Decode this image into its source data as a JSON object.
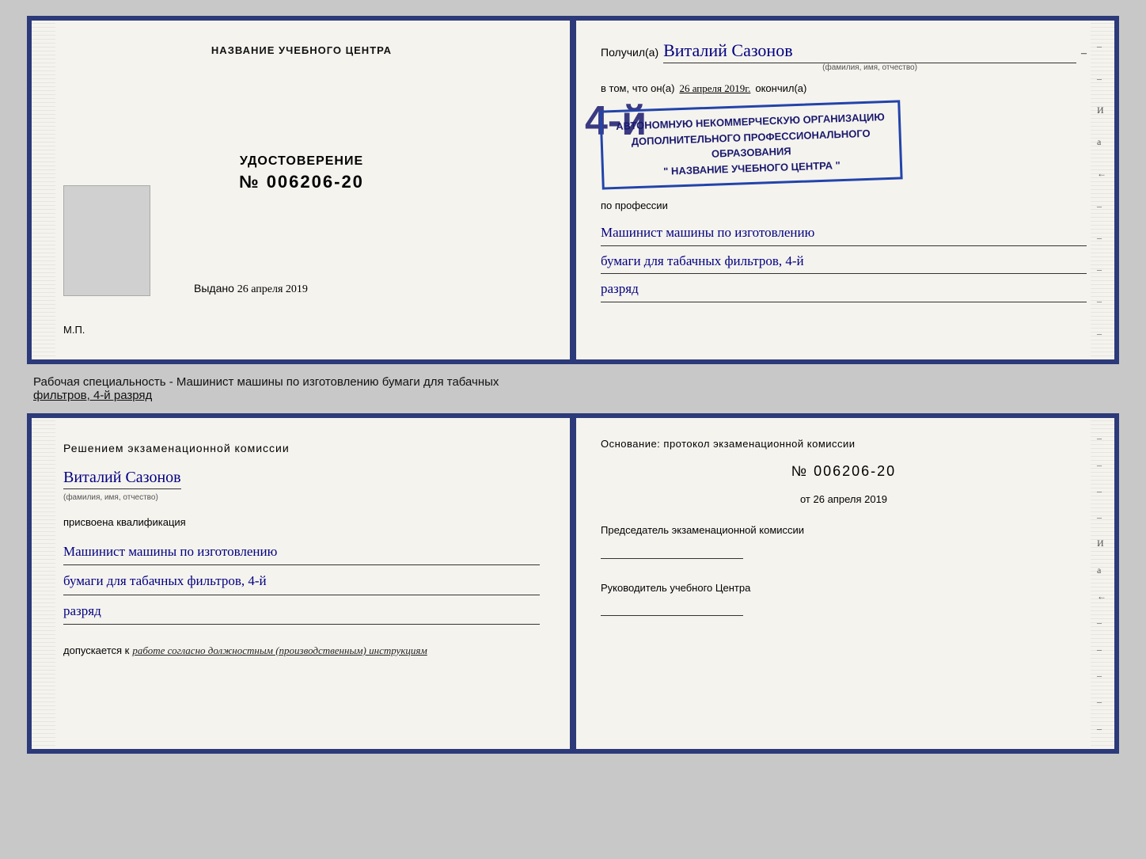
{
  "cert": {
    "left": {
      "header": "НАЗВАНИЕ УЧЕБНОГО ЦЕНТРА",
      "title": "УДОСТОВЕРЕНИЕ",
      "number": "№ 006206-20",
      "issued_label": "Выдано",
      "issued_date": "26 апреля 2019",
      "mp": "М.П."
    },
    "right": {
      "recipient_prefix": "Получил(а)",
      "recipient_name": "Виталий Сазонов",
      "recipient_sub": "(фамилия, имя, отчество)",
      "date_prefix": "в том, что он(а)",
      "date_value": "26 апреля 2019г.",
      "finished_label": "окончил(а)",
      "stamp_4": "4-й",
      "stamp_line1": "АВТОНОМНУЮ НЕКОММЕРЧЕСКУЮ ОРГАНИЗАЦИЮ",
      "stamp_line2": "ДОПОЛНИТЕЛЬНОГО ПРОФЕССИОНАЛЬНОГО ОБРАЗОВАНИЯ",
      "stamp_line3": "\" НАЗВАНИЕ УЧЕБНОГО ЦЕНТРА \"",
      "profession_label": "по профессии",
      "profession_line1": "Машинист машины по изготовлению",
      "profession_line2": "бумаги для табачных фильтров, 4-й",
      "profession_line3": "разряд"
    }
  },
  "middle": {
    "text": "Рабочая специальность - Машинист машины по изготовлению бумаги для табачных",
    "text2": "фильтров, 4-й разряд"
  },
  "bottom": {
    "left": {
      "commission_title": "Решением  экзаменационной  комиссии",
      "name": "Виталий Сазонов",
      "name_sub": "(фамилия, имя, отчество)",
      "qual_label": "присвоена квалификация",
      "qual_line1": "Машинист машины по изготовлению",
      "qual_line2": "бумаги для табачных фильтров, 4-й",
      "qual_line3": "разряд",
      "допускается_prefix": "допускается к",
      "допускается_text": "работе согласно должностным (производственным) инструкциям"
    },
    "right": {
      "osnov_label": "Основание: протокол экзаменационной  комиссии",
      "protocol_number": "№  006206-20",
      "from_label": "от",
      "from_date": "26 апреля 2019",
      "chairman_label": "Председатель экзаменационной комиссии",
      "head_label": "Руководитель учебного Центра"
    }
  }
}
